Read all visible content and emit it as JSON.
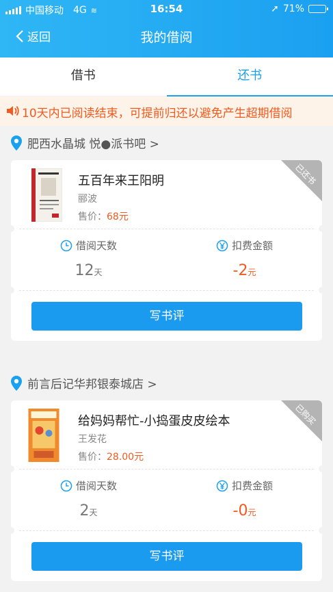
{
  "status_bar": {
    "carrier": "中国移动",
    "network": "4G",
    "time": "16:54",
    "battery": "71%",
    "battery_level": 0.71
  },
  "nav": {
    "back_label": "返回",
    "title": "我的借阅"
  },
  "tabs": [
    {
      "label": "借书"
    },
    {
      "label": "还书",
      "active": true
    }
  ],
  "notice": {
    "text": "10天内已阅读结束，可提前归还以避免产生超期借阅"
  },
  "accent_color": "#1aa0f0",
  "warn_color": "#f25a1f",
  "records": [
    {
      "store": "肥西水晶城 悦●派书吧 >",
      "badge": "已还书",
      "title": "五百年来王阳明",
      "author": "郦波",
      "price_label": "售价：",
      "price": "68元",
      "days_label": "借阅天数",
      "days_value": "12",
      "days_unit": "天",
      "fee_label": "扣费金额",
      "fee_value": "-2",
      "fee_unit": "元",
      "button": "写书评"
    },
    {
      "store": "前言后记华邦银泰城店 >",
      "badge": "已购买",
      "title": "给妈妈帮忙-小捣蛋皮皮绘本",
      "author": "王发花",
      "price_label": "售价：",
      "price": "28.00元",
      "days_label": "借阅天数",
      "days_value": "2",
      "days_unit": "天",
      "fee_label": "扣费金额",
      "fee_value": "-0",
      "fee_unit": "元",
      "button": "写书评"
    }
  ]
}
